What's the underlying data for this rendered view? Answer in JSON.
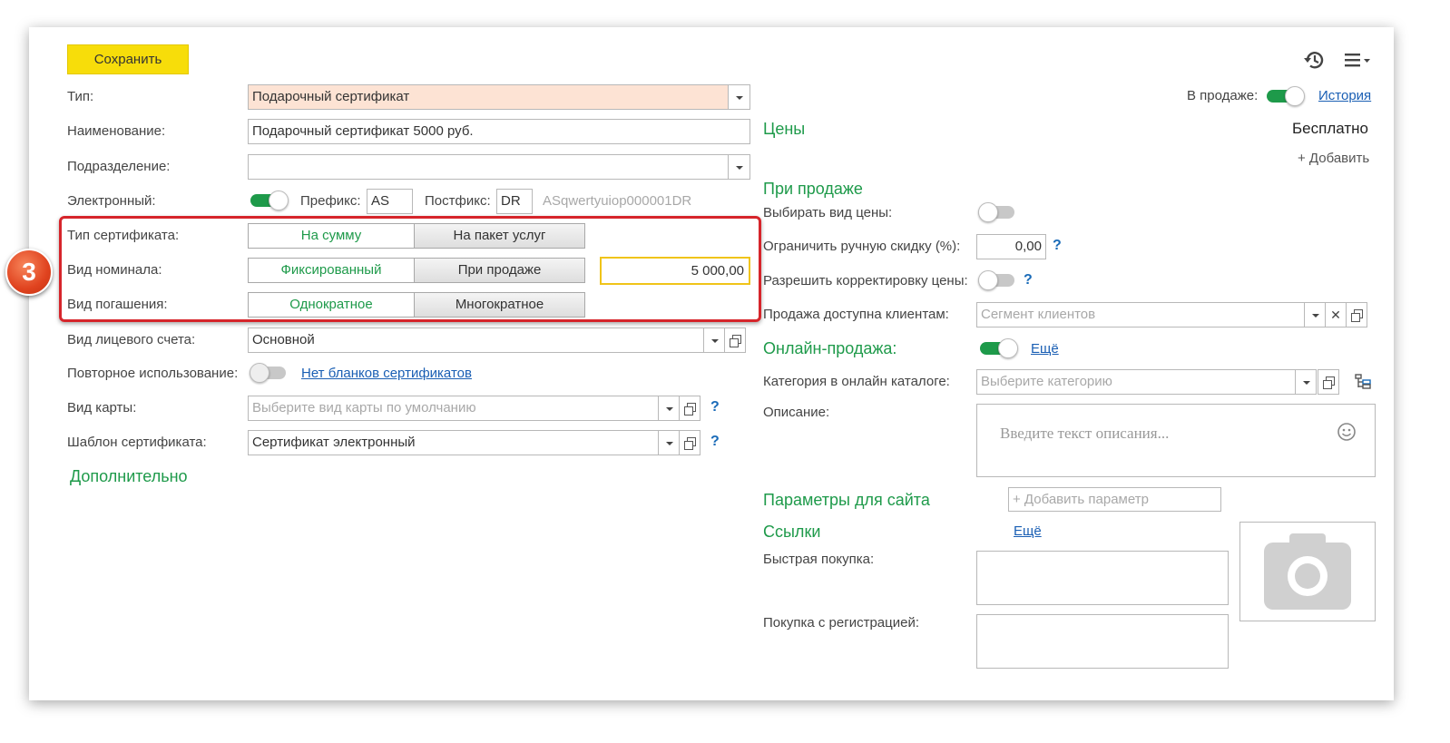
{
  "toolbar": {
    "save_label": "Сохранить",
    "history_icon": "history-icon",
    "menu_icon": "menu-icon"
  },
  "left": {
    "type_label": "Тип:",
    "type_value": "Подарочный сертификат",
    "name_label": "Наименование:",
    "name_value": "Подарочный сертификат 5000 руб.",
    "division_label": "Подразделение:",
    "division_value": "",
    "electronic_label": "Электронный:",
    "prefix_label": "Префикс:",
    "prefix_value": "AS",
    "postfix_label": "Постфикс:",
    "postfix_value": "DR",
    "code_preview": "ASqwertyuiop000001DR",
    "cert_type_label": "Тип сертификата:",
    "cert_type_options": [
      "На сумму",
      "На пакет услуг"
    ],
    "nominal_label": "Вид номинала:",
    "nominal_options": [
      "Фиксированный",
      "При продаже"
    ],
    "nominal_value": "5 000,00",
    "redeem_label": "Вид погашения:",
    "redeem_options": [
      "Однократное",
      "Многократное"
    ],
    "account_label": "Вид лицевого счета:",
    "account_value": "Основной",
    "reuse_label": "Повторное использование:",
    "reuse_link": "Нет бланков сертификатов",
    "card_label": "Вид карты:",
    "card_placeholder": "Выберите вид карты по умолчанию",
    "template_label": "Шаблон сертификата:",
    "template_value": "Сертификат электронный",
    "additional": "Дополнительно",
    "step_badge": "3"
  },
  "right": {
    "on_sale_label": "В продаже:",
    "history_link": "История",
    "prices_header": "Цены",
    "free_label": "Бесплатно",
    "add_label": "+ Добавить",
    "on_sale_header": "При продаже",
    "choose_price_label": "Выбирать вид цены:",
    "limit_discount_label": "Ограничить ручную скидку (%):",
    "limit_discount_value": "0,00",
    "allow_correction_label": "Разрешить корректировку цены:",
    "clients_label": "Продажа доступна клиентам:",
    "clients_placeholder": "Сегмент клиентов",
    "online_header": "Онлайн-продажа:",
    "online_more": "Ещё",
    "category_label": "Категория в онлайн каталоге:",
    "category_placeholder": "Выберите категорию",
    "description_label": "Описание:",
    "description_placeholder": "Введите текст описания...",
    "site_params_header": "Параметры для сайта",
    "add_param_placeholder": "+ Добавить параметр",
    "links_header": "Ссылки",
    "links_more": "Ещё",
    "quick_buy_label": "Быстрая покупка:",
    "reg_buy_label": "Покупка с регистрацией:"
  },
  "colors": {
    "accent_green": "#1e9a4a",
    "save_yellow": "#f7dd0a",
    "highlight_red": "#d6252b",
    "type_field_bg": "#fde3d4"
  }
}
